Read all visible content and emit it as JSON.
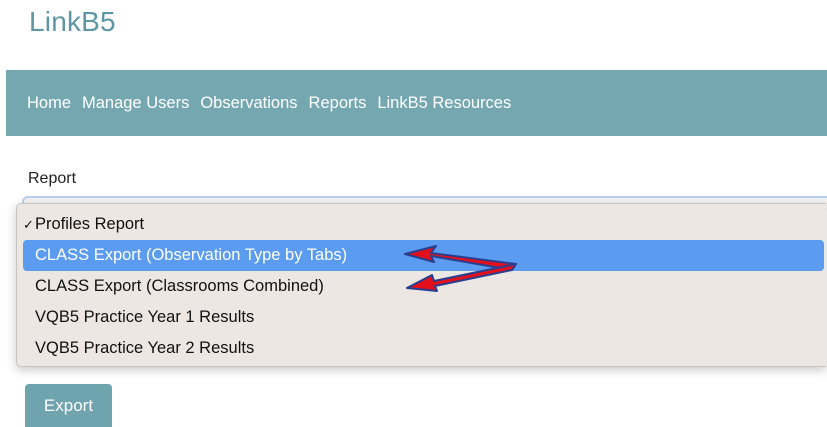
{
  "app": {
    "title": "LinkB5"
  },
  "nav": {
    "items": [
      {
        "label": "Home"
      },
      {
        "label": "Manage Users"
      },
      {
        "label": "Observations"
      },
      {
        "label": "Reports"
      },
      {
        "label": "LinkB5 Resources"
      }
    ]
  },
  "form": {
    "report_label": "Report",
    "export_label": "Export"
  },
  "dropdown": {
    "checkmark": "✓",
    "options": [
      {
        "label": "Profiles Report",
        "selected": true
      },
      {
        "label": "CLASS Export (Observation Type by Tabs)",
        "highlighted": true
      },
      {
        "label": "CLASS Export (Classrooms Combined)"
      },
      {
        "label": "VQB5 Practice Year 1 Results"
      },
      {
        "label": "VQB5 Practice Year 2 Results"
      }
    ]
  },
  "colors": {
    "brand": "#5f96a3",
    "nav_background": "#74a7b0",
    "highlight": "#5b9cf0",
    "dropdown_background": "#ece7e2",
    "annotation_arrow": "#e3101c",
    "annotation_outline": "#2a3f8f"
  }
}
